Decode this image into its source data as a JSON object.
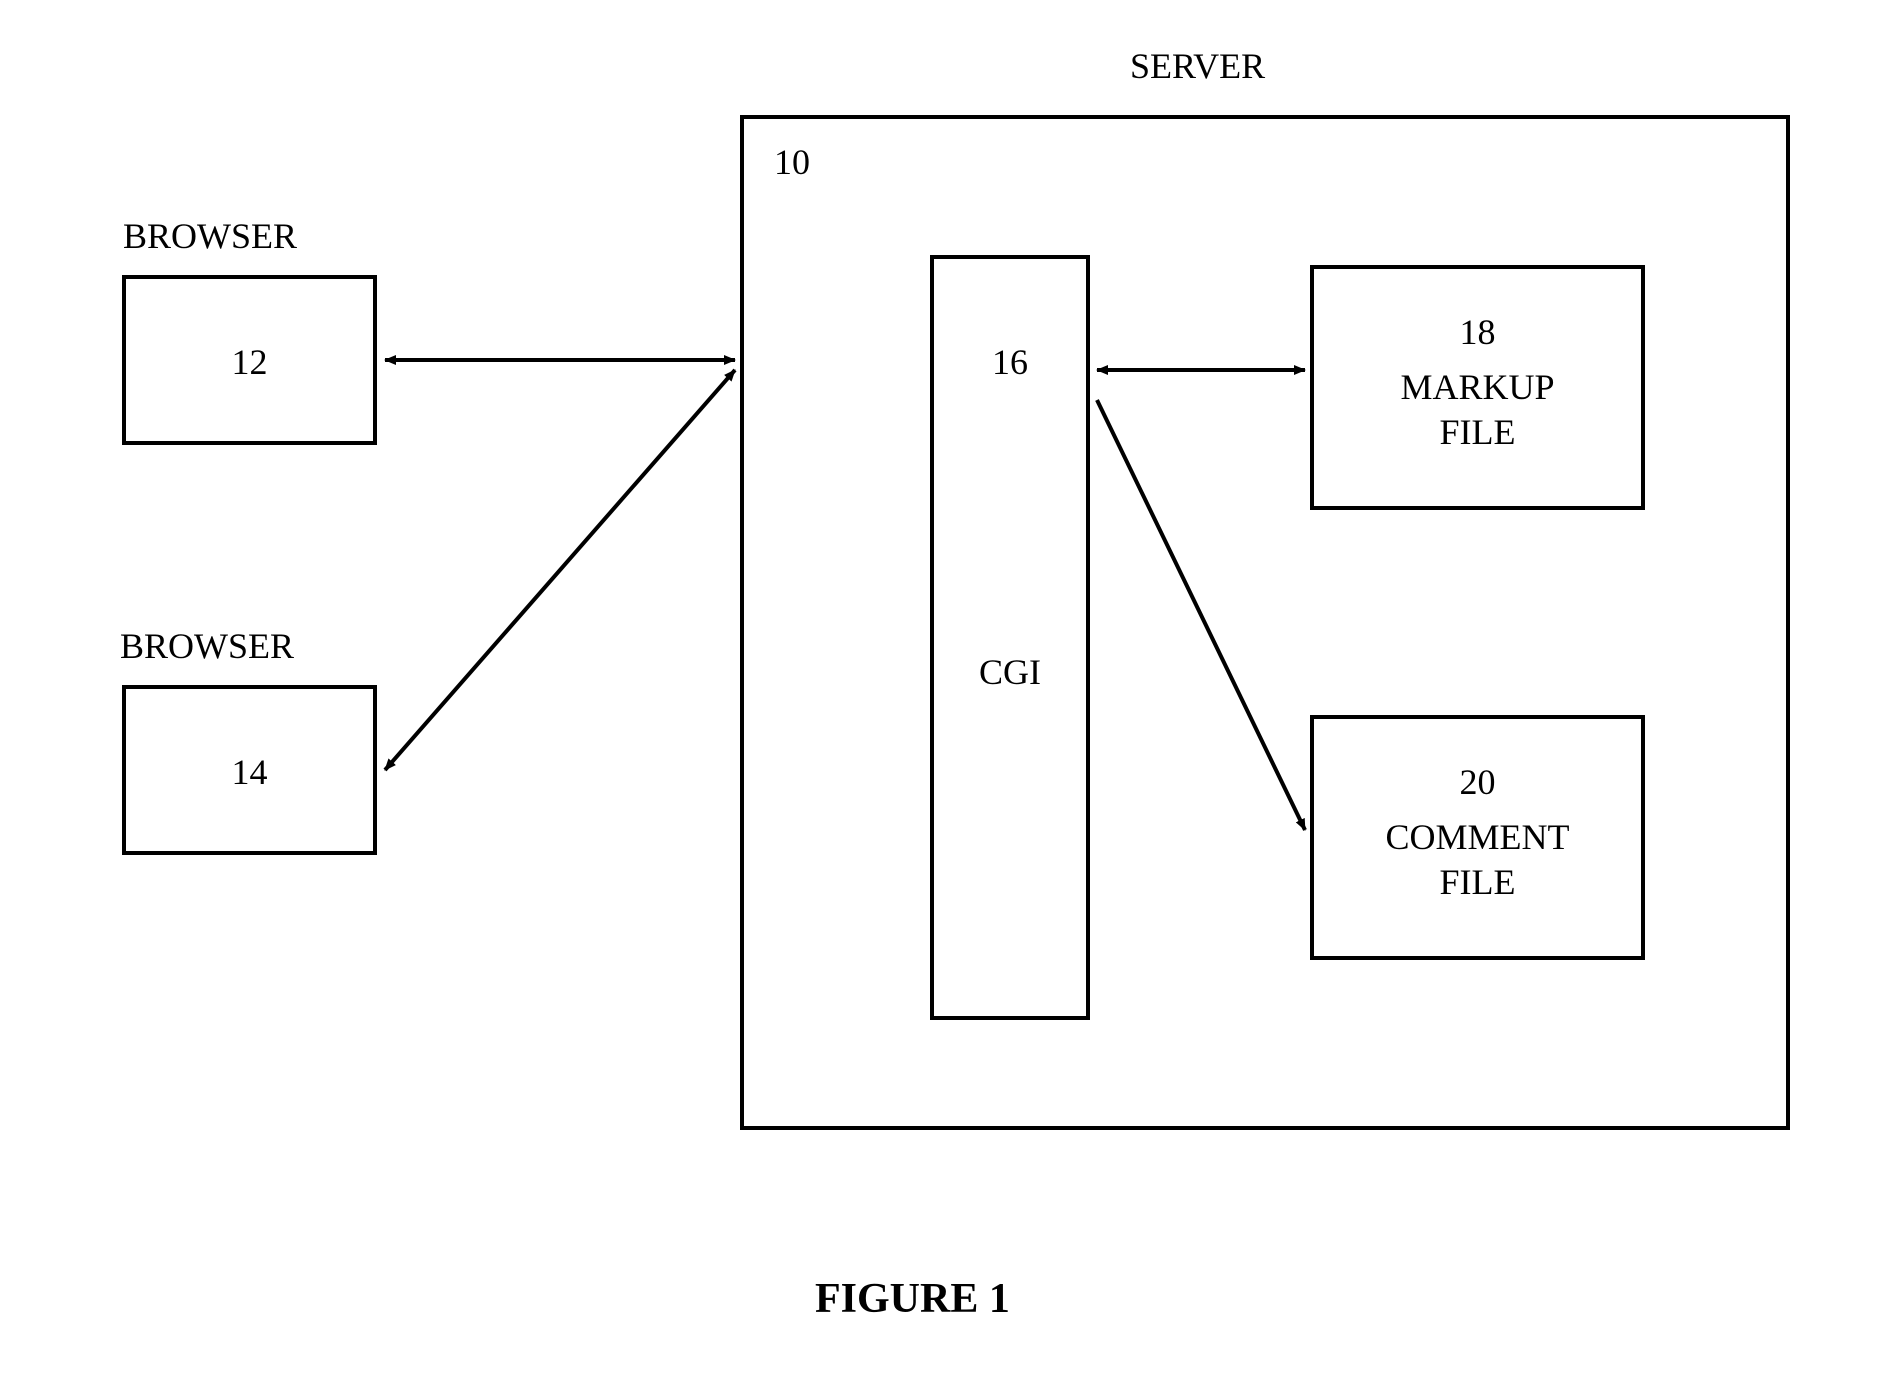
{
  "labels": {
    "server": "SERVER",
    "browser1": "BROWSER",
    "browser2": "BROWSER"
  },
  "boxes": {
    "server_id": "10",
    "browser1_id": "12",
    "browser2_id": "14",
    "cgi_id": "16",
    "cgi_name": "CGI",
    "markup_id": "18",
    "markup_name_l1": "MARKUP",
    "markup_name_l2": "FILE",
    "comment_id": "20",
    "comment_name_l1": "COMMENT",
    "comment_name_l2": "FILE"
  },
  "figure": "FIGURE 1"
}
